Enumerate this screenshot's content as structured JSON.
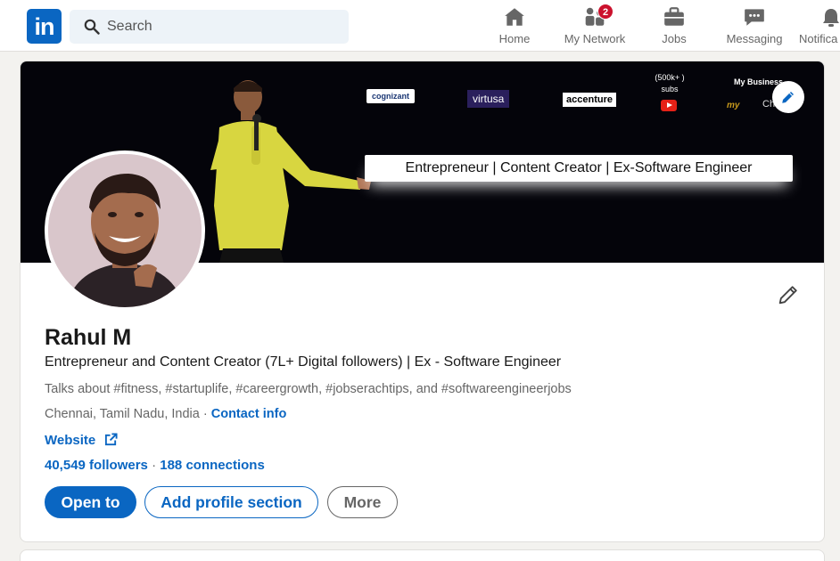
{
  "nav": {
    "logo_text": "in",
    "search_placeholder": "Search",
    "items": [
      {
        "label": "Home",
        "icon": "home-icon"
      },
      {
        "label": "My Network",
        "icon": "people-icon",
        "badge": "2"
      },
      {
        "label": "Jobs",
        "icon": "briefcase-icon"
      },
      {
        "label": "Messaging",
        "icon": "chat-icon"
      },
      {
        "label": "Notifica",
        "icon": "bell-icon"
      }
    ]
  },
  "banner": {
    "brands": [
      "cognizant",
      "virtusa",
      "accenture"
    ],
    "subs_line1": "(500k+ )",
    "subs_line2": "subs",
    "my_business": "My Business",
    "my_logo": "my",
    "ch": "Ch",
    "tagline": "Entrepreneur | Content Creator | Ex-Software Engineer"
  },
  "profile": {
    "name": "Rahul M",
    "headline": "Entrepreneur and Content Creator (7L+ Digital followers) | Ex - Software Engineer",
    "talks_about": "Talks about #fitness, #startuplife, #careergrowth, #jobserachtips, and #softwareengineerjobs",
    "location": "Chennai, Tamil Nadu, India",
    "location_sep": " · ",
    "contact_info": "Contact info",
    "website": "Website",
    "followers": "40,549 followers",
    "stats_sep": " · ",
    "connections": "188 connections"
  },
  "actions": {
    "open_to": "Open to",
    "add_section": "Add profile section",
    "more": "More"
  },
  "colors": {
    "brand": "#0a66c2",
    "badge": "#cb112d",
    "background": "#f3f2ef"
  }
}
